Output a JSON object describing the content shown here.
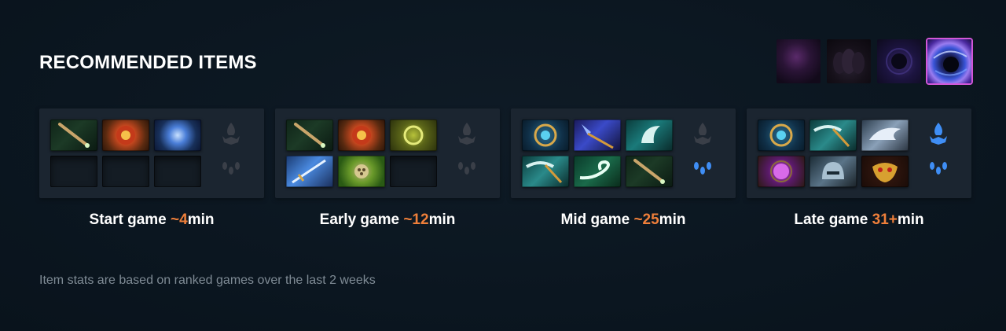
{
  "section": {
    "title": "RECOMMENDED ITEMS",
    "footer_note": "Item stats are based on ranked games over the last 2 weeks"
  },
  "skills": [
    {
      "icon": "skill-1-icon",
      "selected": false
    },
    {
      "icon": "skill-2-icon",
      "selected": false
    },
    {
      "icon": "skill-3-icon",
      "selected": false
    },
    {
      "icon": "skill-4-icon",
      "selected": true
    }
  ],
  "phases": [
    {
      "label_pre": "Start game ",
      "label_time": "~4",
      "label_post": "min",
      "items": [
        "staff-item-icon",
        "orb-item-icon",
        "crystal-orb-item-icon",
        "empty",
        "empty",
        "empty"
      ],
      "neutral_active": false
    },
    {
      "label_pre": "Early game ",
      "label_time": "~12",
      "label_post": "min",
      "items": [
        "staff-item-icon",
        "orb-item-icon",
        "gold-ring-item-icon",
        "sword-item-icon",
        "lotus-item-icon",
        "empty"
      ],
      "neutral_active": false
    },
    {
      "label_pre": "Mid game ",
      "label_time": "~25",
      "label_post": "min",
      "items": [
        "compass-item-icon",
        "blue-staff-item-icon",
        "axe-item-icon",
        "scythe-item-icon",
        "wind-item-icon",
        "staff-item-icon"
      ],
      "neutral_active": false
    },
    {
      "label_pre": "Late game ",
      "label_time": "31+",
      "label_post": "min",
      "items": [
        "compass-item-icon",
        "scythe-item-icon",
        "wings-item-icon",
        "amulet-item-icon",
        "helm-item-icon",
        "gold-mask-item-icon"
      ],
      "neutral_active": true
    }
  ],
  "colors": {
    "accent_orange": "#ef7f3a",
    "selected_border": "#d257d8",
    "neutral_active": "#3f8ef5",
    "neutral_inactive": "#3a3f48"
  }
}
